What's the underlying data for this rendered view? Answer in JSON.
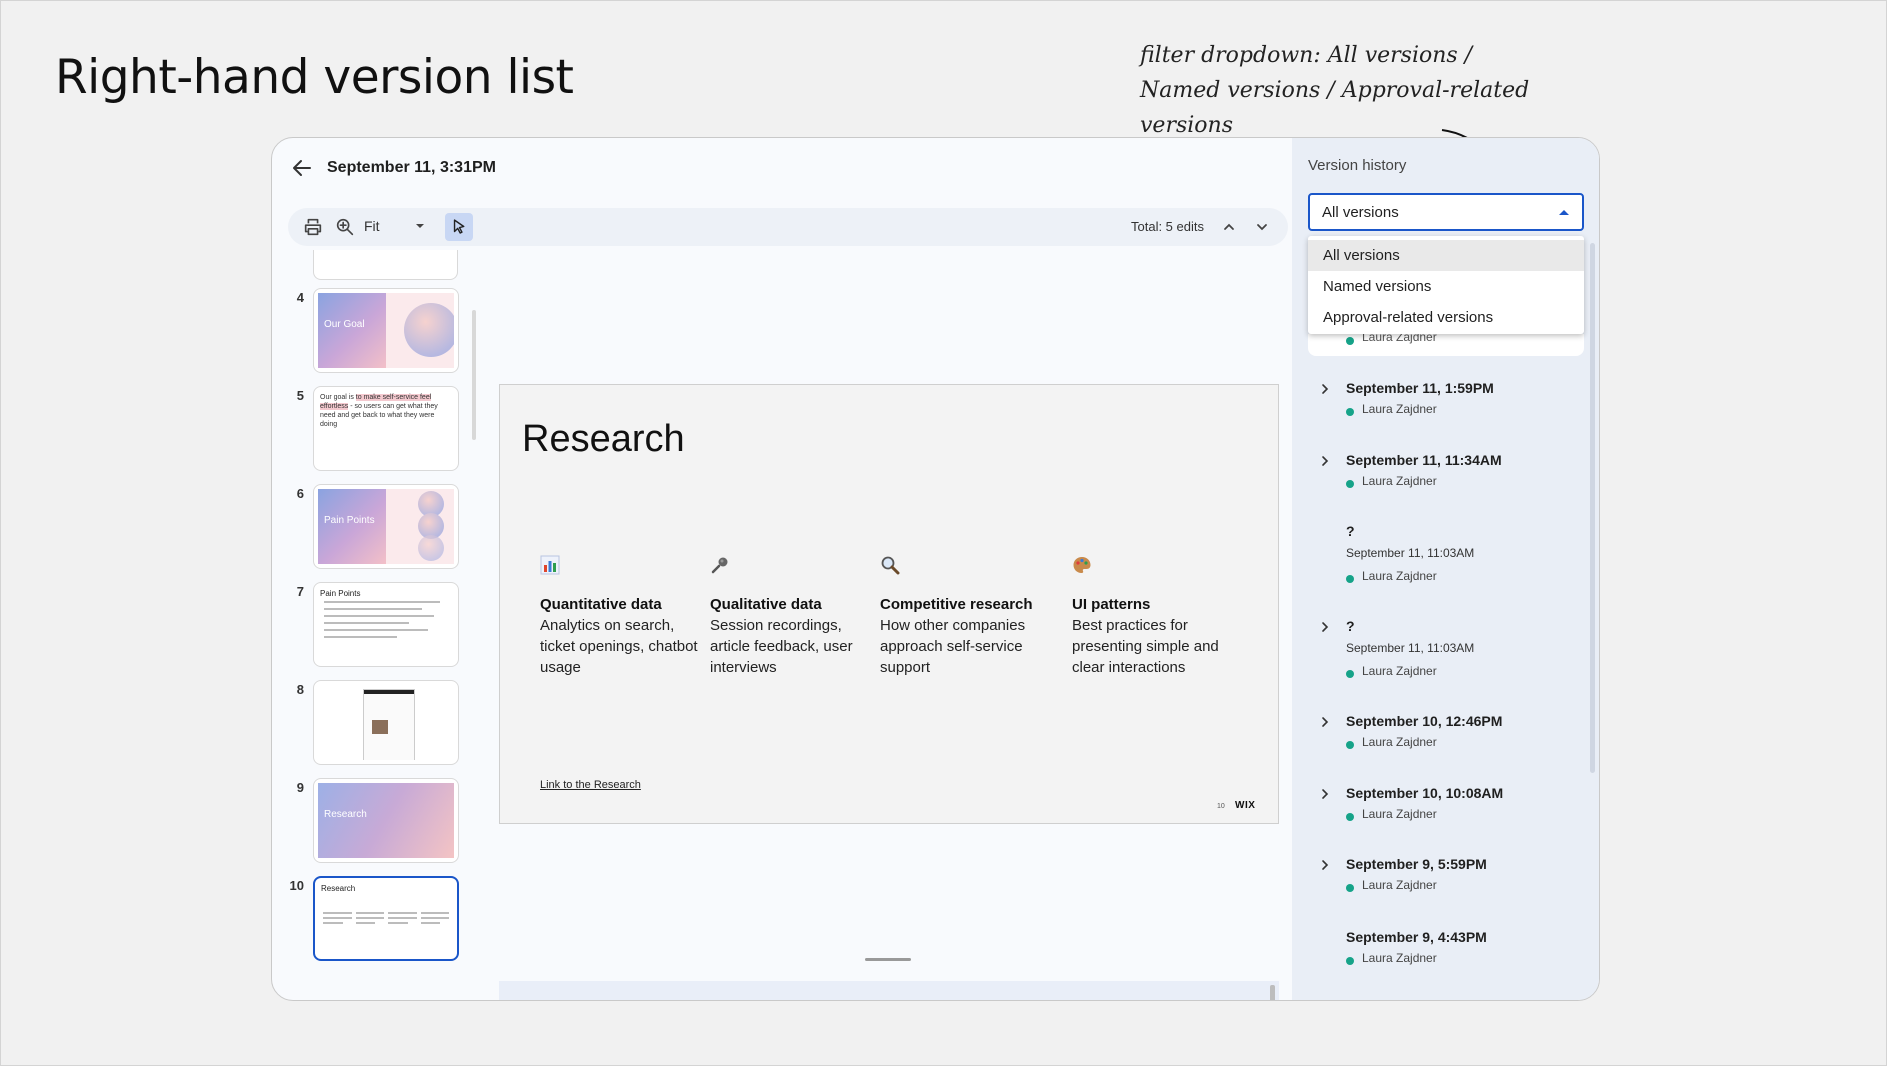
{
  "page": {
    "heading": "Right-hand version list",
    "annotation": "filter dropdown: All versions / Named versions / Approval-related versions"
  },
  "viewer": {
    "title": "September 11, 3:31PM",
    "toolbar": {
      "print_icon": "printer-icon",
      "zoom_icon": "zoom-in-icon",
      "fit_label": "Fit",
      "select_tool_icon": "pointer-icon",
      "total_edits": "Total: 5 edits"
    }
  },
  "thumbnails": [
    {
      "number": "4",
      "label": "Our Goal",
      "style": "gradient-orb"
    },
    {
      "number": "5",
      "text_before": "Our goal is ",
      "text_highlight": "to make self-service feel effortless",
      "text_after": " - so users can get what they need and get back to what they were doing",
      "style": "text"
    },
    {
      "number": "6",
      "label": "Pain Points",
      "style": "gradient-spheres"
    },
    {
      "number": "7",
      "title": "Pain Points",
      "style": "bullets"
    },
    {
      "number": "8",
      "style": "mockup"
    },
    {
      "number": "9",
      "label": "Research",
      "style": "gradient-full"
    },
    {
      "number": "10",
      "title": "Research",
      "style": "columns",
      "active": true
    }
  ],
  "slide": {
    "title": "Research",
    "columns": [
      {
        "icon": "bar-chart-icon",
        "heading": "Quantitative data",
        "body": "Analytics on search, ticket openings, chatbot usage"
      },
      {
        "icon": "microphone-icon",
        "heading": "Qualitative data",
        "body": "Session recordings, article feedback, user interviews"
      },
      {
        "icon": "magnifier-icon",
        "heading": "Competitive research",
        "body": "How other companies approach self-service support"
      },
      {
        "icon": "palette-icon",
        "heading": "UI patterns",
        "body": " Best practices for presenting simple and clear interactions"
      }
    ],
    "link": "Link to the Research",
    "number": "10",
    "brand": "WIX"
  },
  "version_history": {
    "title": "Version history",
    "filter": {
      "selected": "All versions",
      "options": [
        "All versions",
        "Named versions",
        "Approval-related versions"
      ]
    },
    "peek_author": "Laura Zajdner",
    "versions": [
      {
        "title": "September 11, 1:59PM",
        "author": "Laura Zajdner",
        "expandable": true
      },
      {
        "title": "September 11, 11:34AM",
        "author": "Laura Zajdner",
        "expandable": true
      },
      {
        "title": "?",
        "subtitle": "September 11, 11:03AM",
        "author": "Laura Zajdner",
        "expandable": false
      },
      {
        "title": "?",
        "subtitle": "September 11, 11:03AM",
        "author": "Laura Zajdner",
        "expandable": true
      },
      {
        "title": "September 10, 12:46PM",
        "author": "Laura Zajdner",
        "expandable": true
      },
      {
        "title": "September 10, 10:08AM",
        "author": "Laura Zajdner",
        "expandable": true
      },
      {
        "title": "September 9, 5:59PM",
        "author": "Laura Zajdner",
        "expandable": true
      },
      {
        "title": "September 9, 4:43PM",
        "author": "Laura Zajdner",
        "expandable": false
      }
    ],
    "author_dot_color": "#16a389",
    "accent_color": "#1a56c9"
  }
}
